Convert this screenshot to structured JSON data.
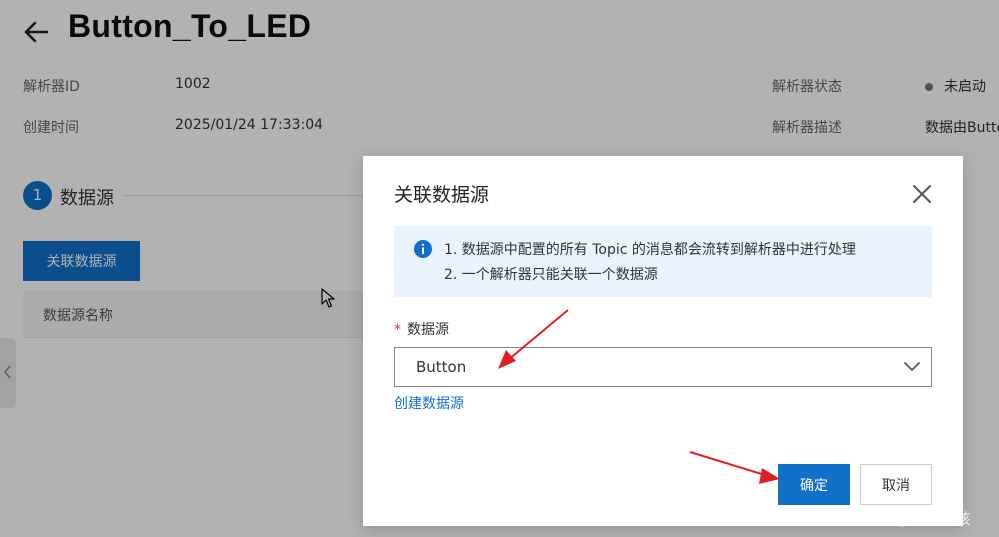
{
  "page": {
    "title": "Button_To_LED",
    "info": [
      {
        "label": "解析器ID",
        "value": "1002"
      },
      {
        "label": "创建时间",
        "value": "2025/01/24 17:33:04"
      },
      {
        "label": "解析器状态",
        "value": "未启动"
      },
      {
        "label": "解析器描述",
        "value": "数据由Button"
      }
    ],
    "step": {
      "number": "1",
      "label": "数据源"
    },
    "bind_button": "关联数据源",
    "table_header": "数据源名称"
  },
  "dialog": {
    "title": "关联数据源",
    "notice": [
      "1. 数据源中配置的所有 Topic 的消息都会流转到解析器中进行处理",
      "2. 一个解析器只能关联一个数据源"
    ],
    "field": {
      "required_mark": "*",
      "label": "数据源",
      "selected_value": "Button"
    },
    "create_link": "创建数据源",
    "confirm": "确定",
    "cancel": "取消"
  },
  "watermark": "CSDN @风行男孩",
  "colors": {
    "primary": "#1170c9",
    "notice_bg": "#e8f3fd",
    "annotation_arrow": "#e02020",
    "required": "#d9363e"
  },
  "icons": [
    "back-arrow-icon",
    "close-icon",
    "info-icon",
    "chevron-down-icon",
    "chevron-left-icon",
    "mouse-cursor-icon"
  ]
}
